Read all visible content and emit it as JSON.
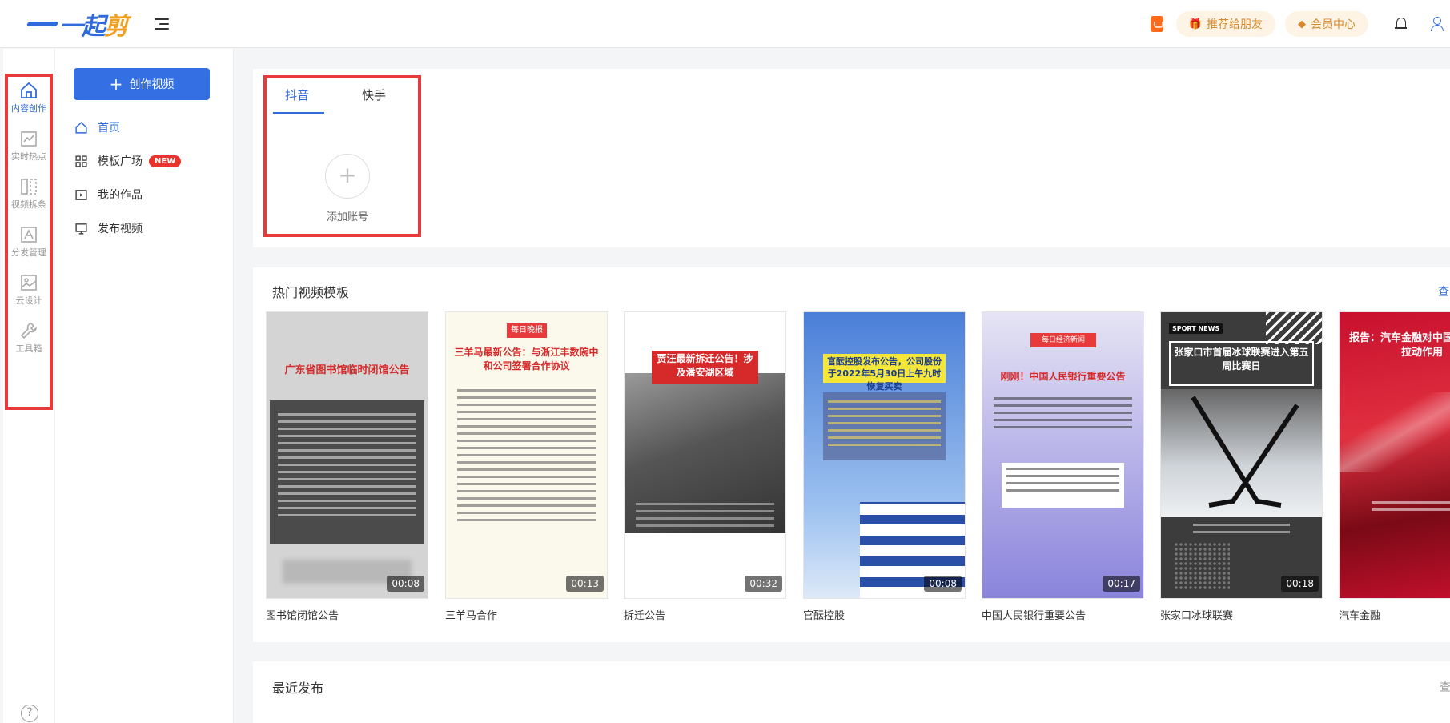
{
  "header": {
    "logo_text_a": "一起",
    "logo_text_b": "剪",
    "recommend_label": "推荐给朋友",
    "member_label": "会员中心"
  },
  "rail": {
    "items": [
      {
        "label": "内容创作",
        "icon": "home-icon",
        "active": true
      },
      {
        "label": "实时热点",
        "icon": "trend-chart-icon",
        "active": false
      },
      {
        "label": "视频拆条",
        "icon": "split-icon",
        "active": false
      },
      {
        "label": "分发管理",
        "icon": "distribute-icon",
        "active": false
      },
      {
        "label": "云设计",
        "icon": "image-icon",
        "active": false
      },
      {
        "label": "工具箱",
        "icon": "wrench-icon",
        "active": false
      }
    ],
    "help": "?"
  },
  "subnav": {
    "create_label": "创作视频",
    "items": [
      {
        "label": "首页",
        "icon": "home-icon",
        "active": true
      },
      {
        "label": "模板广场",
        "icon": "grid-icon",
        "badge": "NEW"
      },
      {
        "label": "我的作品",
        "icon": "play-box-icon"
      },
      {
        "label": "发布视频",
        "icon": "publish-icon"
      }
    ]
  },
  "accounts": {
    "tabs": [
      "抖音",
      "快手"
    ],
    "active_tab": 0,
    "add_label": "添加账号"
  },
  "templates": {
    "title": "热门视频模板",
    "more": "查",
    "items": [
      {
        "name": "图书馆闭馆公告",
        "duration": "00:08",
        "headline": "广东省图书馆临时闭馆公告"
      },
      {
        "name": "三羊马合作",
        "duration": "00:13",
        "tag": "每日晚报",
        "headline": "三羊马最新公告：与浙江丰数碗中和公司签署合作协议"
      },
      {
        "name": "拆迁公告",
        "duration": "00:32",
        "headline": "贾汪最新拆迁公告！涉及潘安湖区域"
      },
      {
        "name": "官酝控股",
        "duration": "00:08",
        "headline": "官酝控股发布公告，公司股份于2022年5月30日上午九时恢复买卖"
      },
      {
        "name": "中国人民银行重要公告",
        "duration": "00:17",
        "tag": "每日经济新闻",
        "headline": "刚刚！中国人民银行重要公告"
      },
      {
        "name": "张家口冰球联赛",
        "duration": "00:18",
        "tag": "SPORT NEWS",
        "headline": "张家口市首届冰球联赛进入第五周比赛日"
      },
      {
        "name": "汽车金融",
        "duration": "",
        "headline": "报告：汽车金融对中国销量增长拉动作用"
      }
    ]
  },
  "recent": {
    "title": "最近发布",
    "more": "查"
  }
}
